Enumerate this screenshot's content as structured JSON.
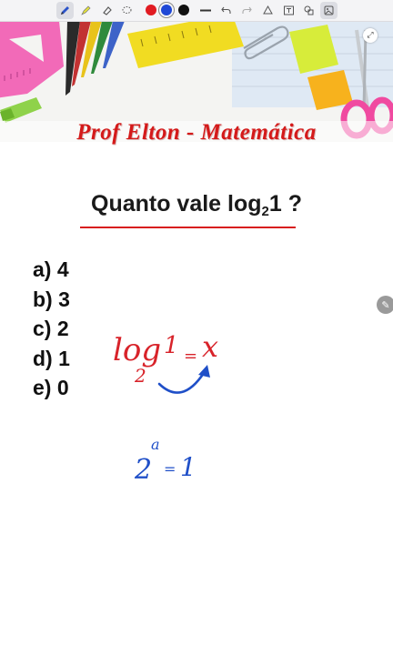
{
  "toolbar": {
    "tools": [
      "pen-tool",
      "highlighter-tool",
      "eraser-tool",
      "lasso-tool"
    ],
    "colors": [
      "#e11b22",
      "#1e47d6",
      "#111111"
    ],
    "selected_color": "#1e47d6",
    "actions": [
      "line-tool",
      "undo",
      "redo",
      "shapes",
      "text-box",
      "shape-select",
      "image"
    ]
  },
  "banner": {
    "title": "Prof Elton - Matemática"
  },
  "question": {
    "prefix": "Quanto vale log",
    "base": "2",
    "argument": "1 ?"
  },
  "options": [
    {
      "label": "a)",
      "value": "4"
    },
    {
      "label": "b)",
      "value": "3"
    },
    {
      "label": "c)",
      "value": "2"
    },
    {
      "label": "d)",
      "value": "1"
    },
    {
      "label": "e)",
      "value": "0"
    }
  ],
  "handwriting": {
    "red": {
      "log": "log",
      "base": "2",
      "arg": "1",
      "eq": "=",
      "var": "x"
    },
    "blue": {
      "base": "2",
      "exp": "a",
      "eq": "=",
      "rhs": "1"
    },
    "red_color": "#d8232a",
    "blue_color": "#1f4fc8"
  }
}
